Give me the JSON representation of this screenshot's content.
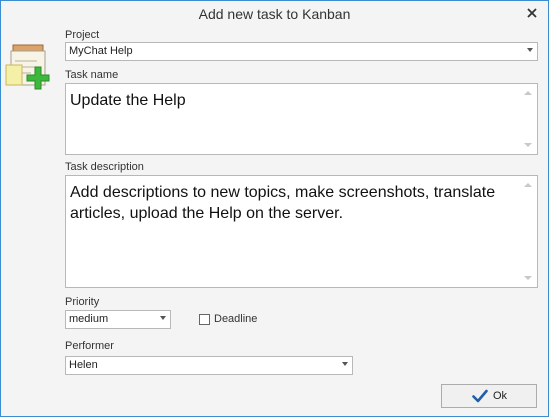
{
  "window": {
    "title": "Add new task to Kanban"
  },
  "icons": {
    "close": "close-icon",
    "app": "task-add-icon",
    "ok": "check-icon"
  },
  "project": {
    "label": "Project",
    "value": "MyChat Help"
  },
  "task_name": {
    "label": "Task name",
    "value": "Update the Help"
  },
  "task_description": {
    "label": "Task description",
    "value": "Add descriptions to new topics, make screenshots, translate articles, upload the Help on the server."
  },
  "priority": {
    "label": "Priority",
    "value": "medium"
  },
  "deadline": {
    "label": "Deadline",
    "checked": false
  },
  "performer": {
    "label": "Performer",
    "value": "Helen"
  },
  "buttons": {
    "ok": "Ok"
  },
  "colors": {
    "window_border": "#3c8cd2",
    "ok_check": "#1e5fa8",
    "icon_green": "#3cb83c"
  }
}
